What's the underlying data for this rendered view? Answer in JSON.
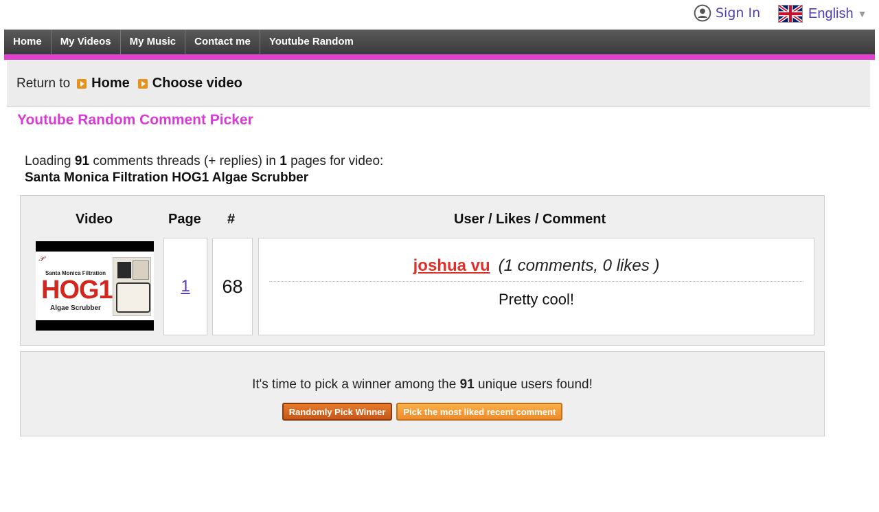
{
  "header": {
    "signin_label": "Sign In",
    "language_label": "English",
    "icons": {
      "user": "user-circle-icon",
      "flag": "uk-flag-icon",
      "caret": "caret-down-icon"
    }
  },
  "nav": {
    "items": [
      {
        "label": "Home"
      },
      {
        "label": "My Videos"
      },
      {
        "label": "My Music"
      },
      {
        "label": "Contact me"
      },
      {
        "label": "Youtube Random"
      }
    ]
  },
  "breadcrumb": {
    "prefix": "Return to",
    "items": [
      {
        "label": "Home"
      },
      {
        "label": "Choose video"
      }
    ]
  },
  "page_title": "Youtube Random Comment Picker",
  "loading": {
    "part1": "Loading",
    "count": "91",
    "part2": "comments threads (+ replies) in",
    "pages": "1",
    "part3": "pages for video:",
    "video_title": "Santa Monica Filtration HOG1 Algae Scrubber"
  },
  "results": {
    "headers": {
      "video": "Video",
      "page": "Page",
      "number": "#",
      "user": "User / Likes / Comment"
    },
    "row": {
      "thumbnail": {
        "line1": "Santa Monica Filtration",
        "big": "HOG1",
        "line2": "Algae Scrubber"
      },
      "page": "1",
      "number": "68",
      "user": "joshua vu",
      "stats": "(1 comments, 0 likes )",
      "comment": "Pretty cool!"
    }
  },
  "winner": {
    "text_before": "It's time to pick a winner among the",
    "count": "91",
    "text_after": "unique users found!",
    "random_button": "Randomly Pick Winner",
    "liked_button": "Pick the most liked recent comment"
  },
  "colors": {
    "accent_pink": "#e040d0",
    "title_pink": "#d83ad6",
    "link_purple": "#4a3fb5",
    "username_red": "#e0302a",
    "button_orange": "#e87a2a"
  }
}
